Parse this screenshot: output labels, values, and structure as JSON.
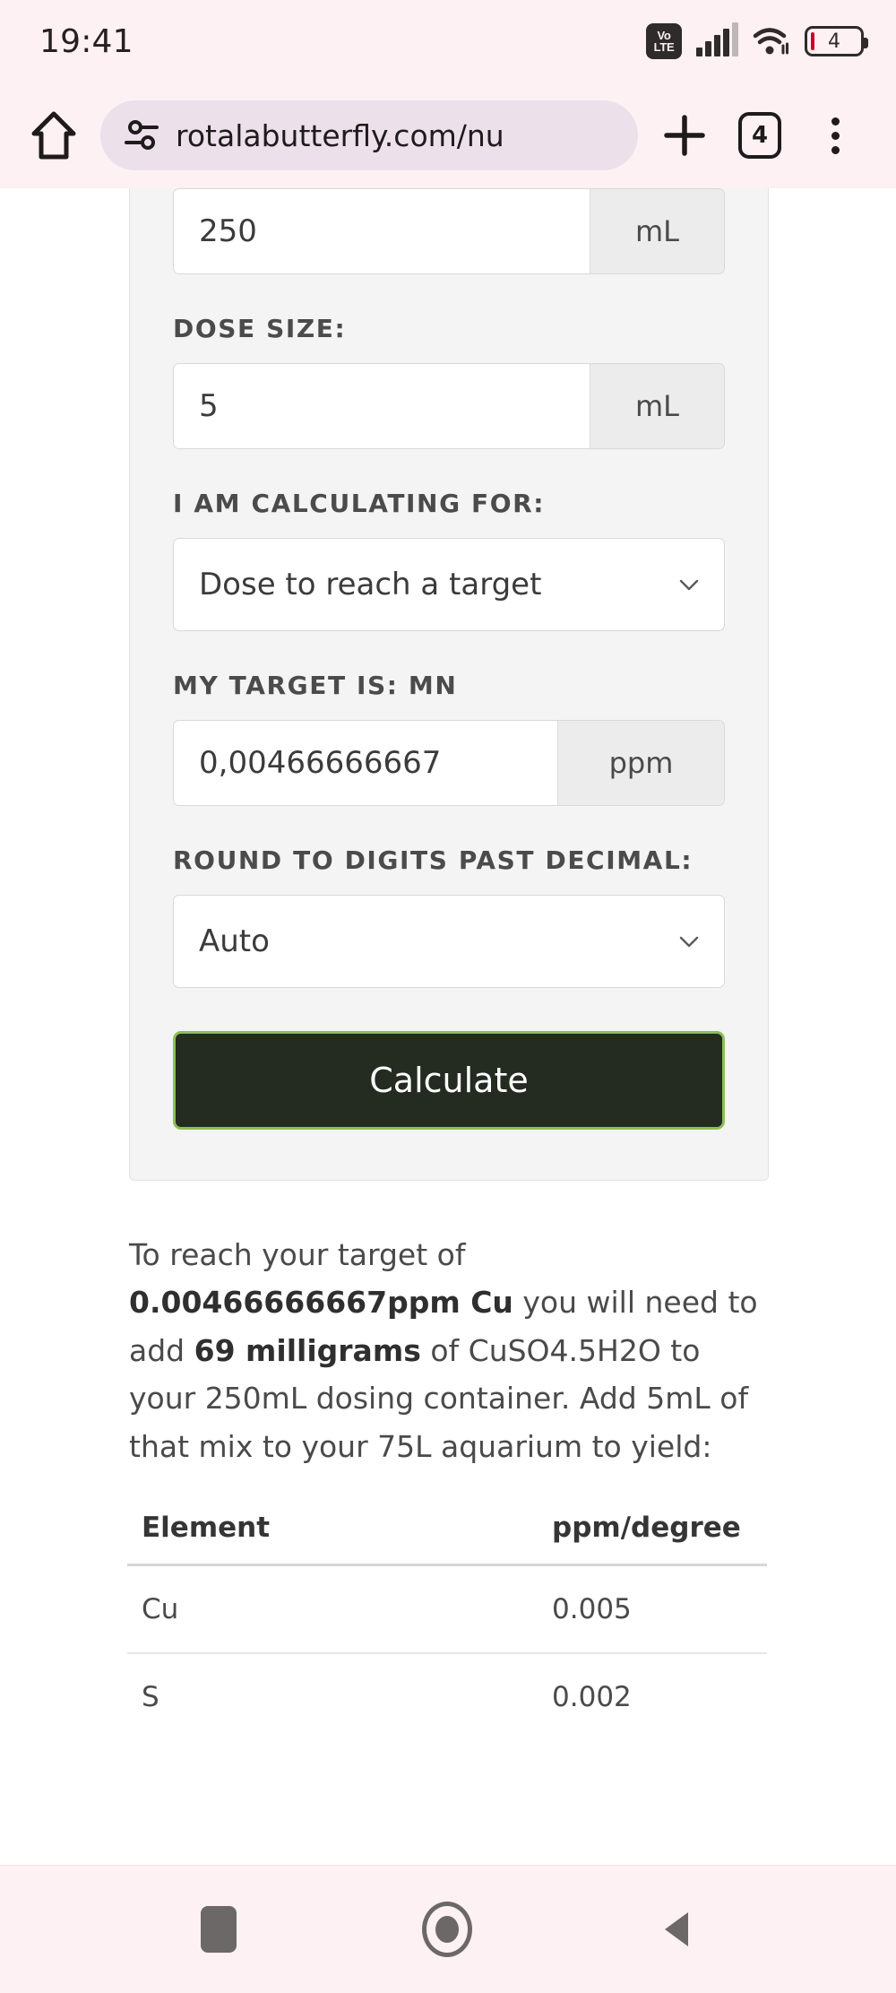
{
  "status_bar": {
    "time": "19:41",
    "volte_top": "Vo",
    "volte_bottom": "LTE",
    "battery_level": "4"
  },
  "browser": {
    "url": "rotalabutterfly.com/nu",
    "tab_count": "4"
  },
  "form": {
    "container_volume": {
      "value": "250",
      "unit": "mL"
    },
    "dose_size": {
      "label": "DOSE SIZE:",
      "value": "5",
      "unit": "mL"
    },
    "calculating_for": {
      "label": "I AM CALCULATING FOR:",
      "selected": "Dose to reach a target"
    },
    "target": {
      "label": "MY TARGET IS: MN",
      "value": "0,00466666667",
      "unit": "ppm"
    },
    "rounding": {
      "label": "ROUND TO DIGITS PAST DECIMAL:",
      "selected": "Auto"
    },
    "calculate_button": "Calculate"
  },
  "result": {
    "intro": "To reach your target of ",
    "target_bold": "0.00466666667ppm Cu",
    "mid1": " you will need to add ",
    "amount_bold": "69 milligrams",
    "mid2": " of CuSO4.5H2O to your 250mL dosing container. Add 5mL of that mix to your 75L aquarium to yield:"
  },
  "table": {
    "headers": [
      "Element",
      "ppm/degree"
    ],
    "rows": [
      {
        "element": "Cu",
        "value": "0.005"
      },
      {
        "element": "S",
        "value": "0.002"
      }
    ]
  },
  "colors": {
    "chrome_tint": "#fdf1f4",
    "url_pill": "#ece0ea",
    "button_fill": "#242b20",
    "button_border": "#8cbf55",
    "panel_bg": "#f4f4f4"
  }
}
